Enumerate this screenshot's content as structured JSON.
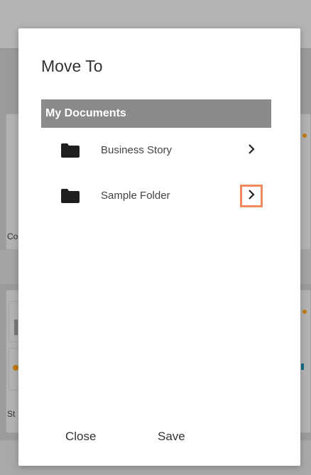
{
  "background": {
    "label_1": "Co",
    "label_2": "St"
  },
  "dialog": {
    "title": "Move To",
    "root_folder": "My Documents",
    "folders": [
      {
        "label": "Business Story",
        "icon": "folder-icon",
        "highlighted": false
      },
      {
        "label": "Sample Folder",
        "icon": "folder-icon",
        "highlighted": true
      }
    ],
    "close_label": "Close",
    "save_label": "Save"
  },
  "colors": {
    "header_bg": "#8a8a8a",
    "highlight": "#ef8a5a"
  }
}
